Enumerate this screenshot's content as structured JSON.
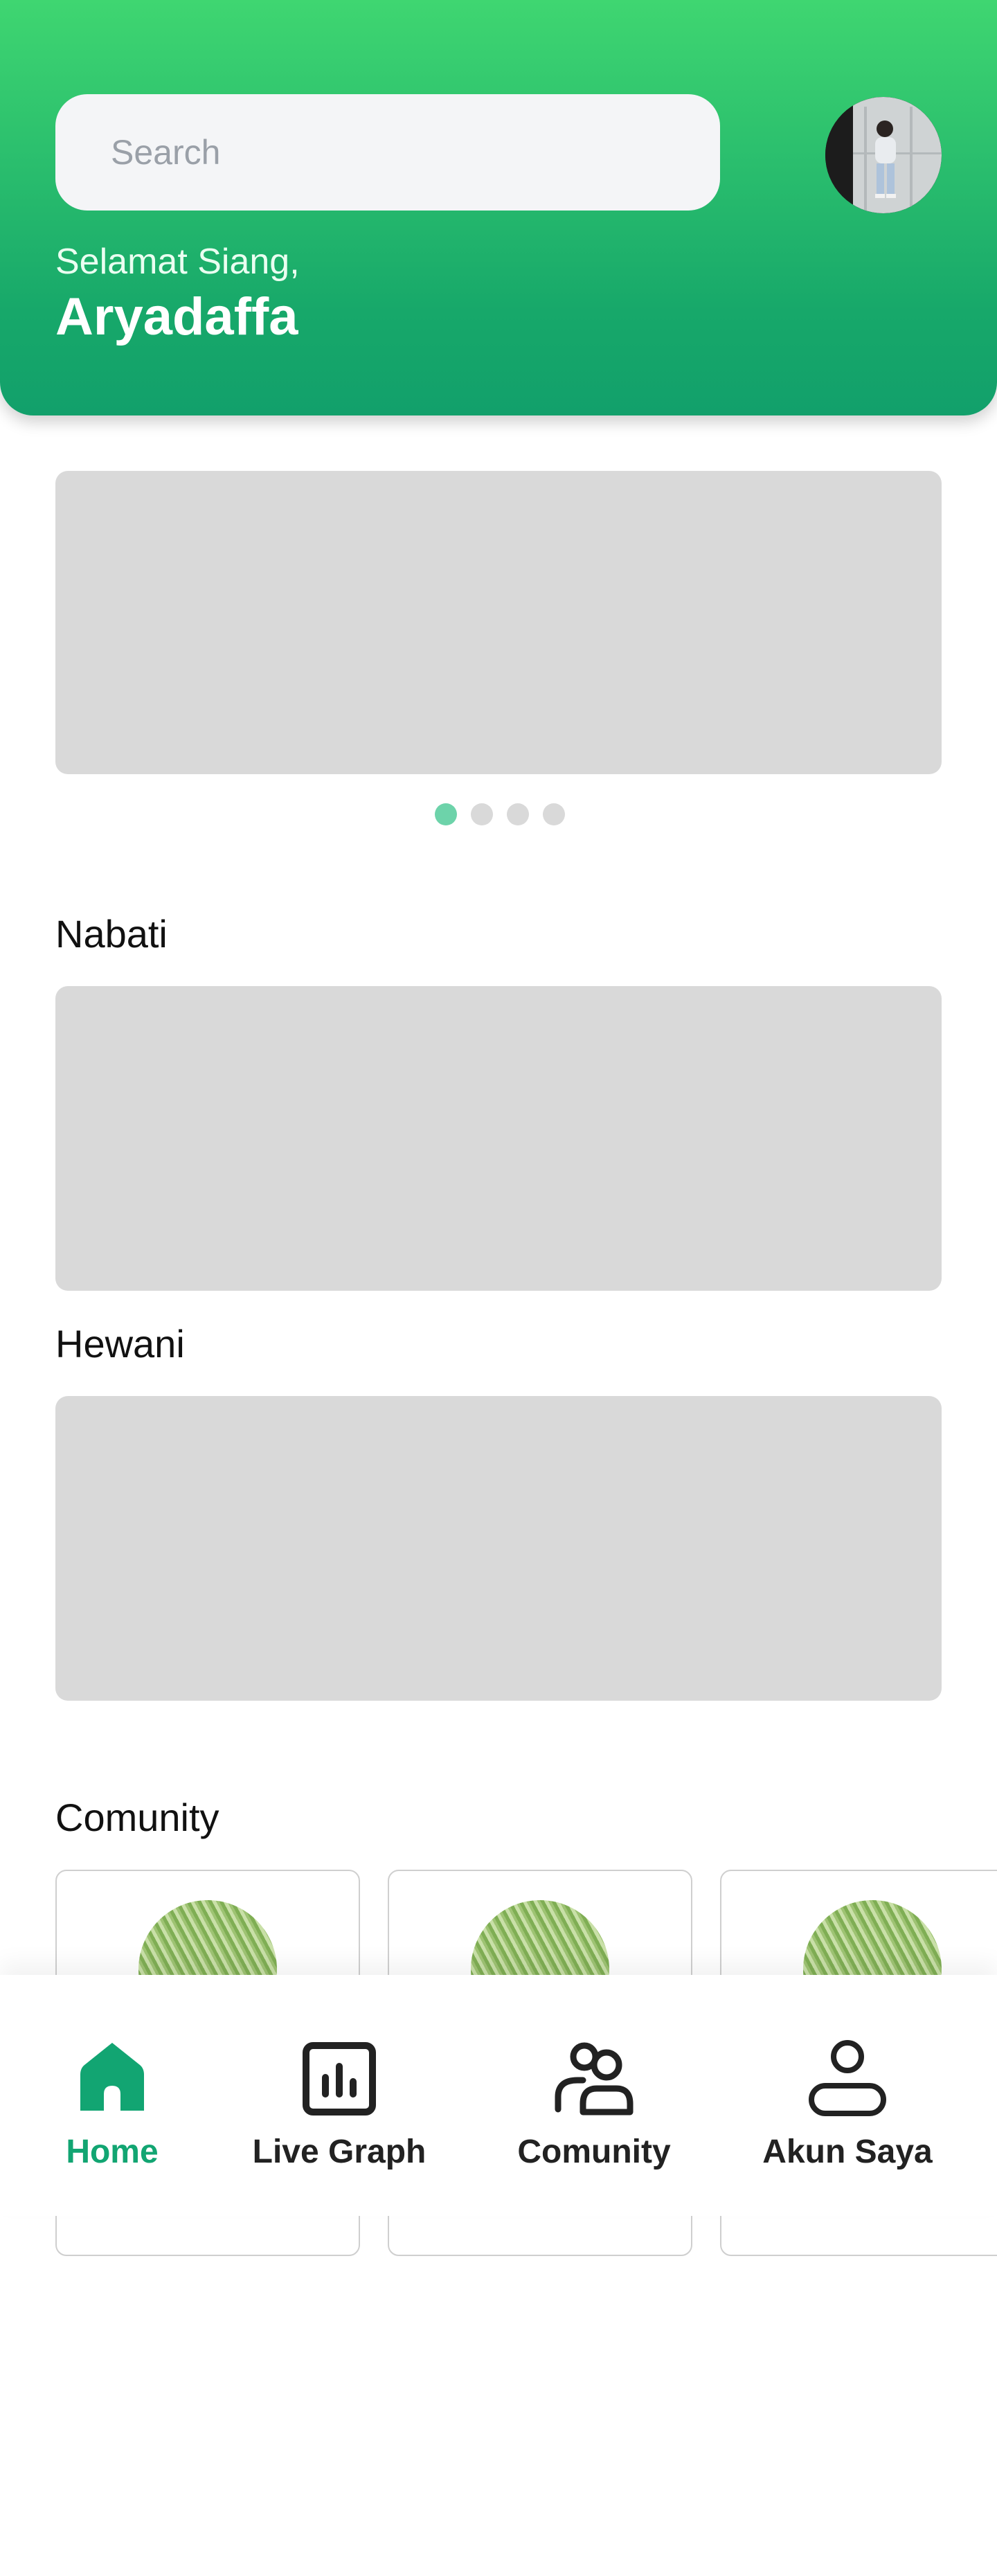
{
  "search": {
    "placeholder": "Search"
  },
  "greeting": {
    "salutation": "Selamat Siang,",
    "name": "Aryadaffa"
  },
  "carousel": {
    "slide_count": 4,
    "active_index": 0
  },
  "sections": {
    "nabati": "Nabati",
    "hewani": "Hewani",
    "comunity": "Comunity"
  },
  "nav": [
    {
      "label": "Home",
      "icon": "home-icon",
      "active": true
    },
    {
      "label": "Live Graph",
      "icon": "bar-chart-icon",
      "active": false
    },
    {
      "label": "Comunity",
      "icon": "community-icon",
      "active": false
    },
    {
      "label": "Akun Saya",
      "icon": "user-icon",
      "active": false
    }
  ],
  "colors": {
    "header_top": "#3fd671",
    "header_bottom": "#12a06b",
    "accent": "#12a572",
    "active_dot": "#6dd3aa",
    "placeholder_block": "#d9d9d9"
  }
}
